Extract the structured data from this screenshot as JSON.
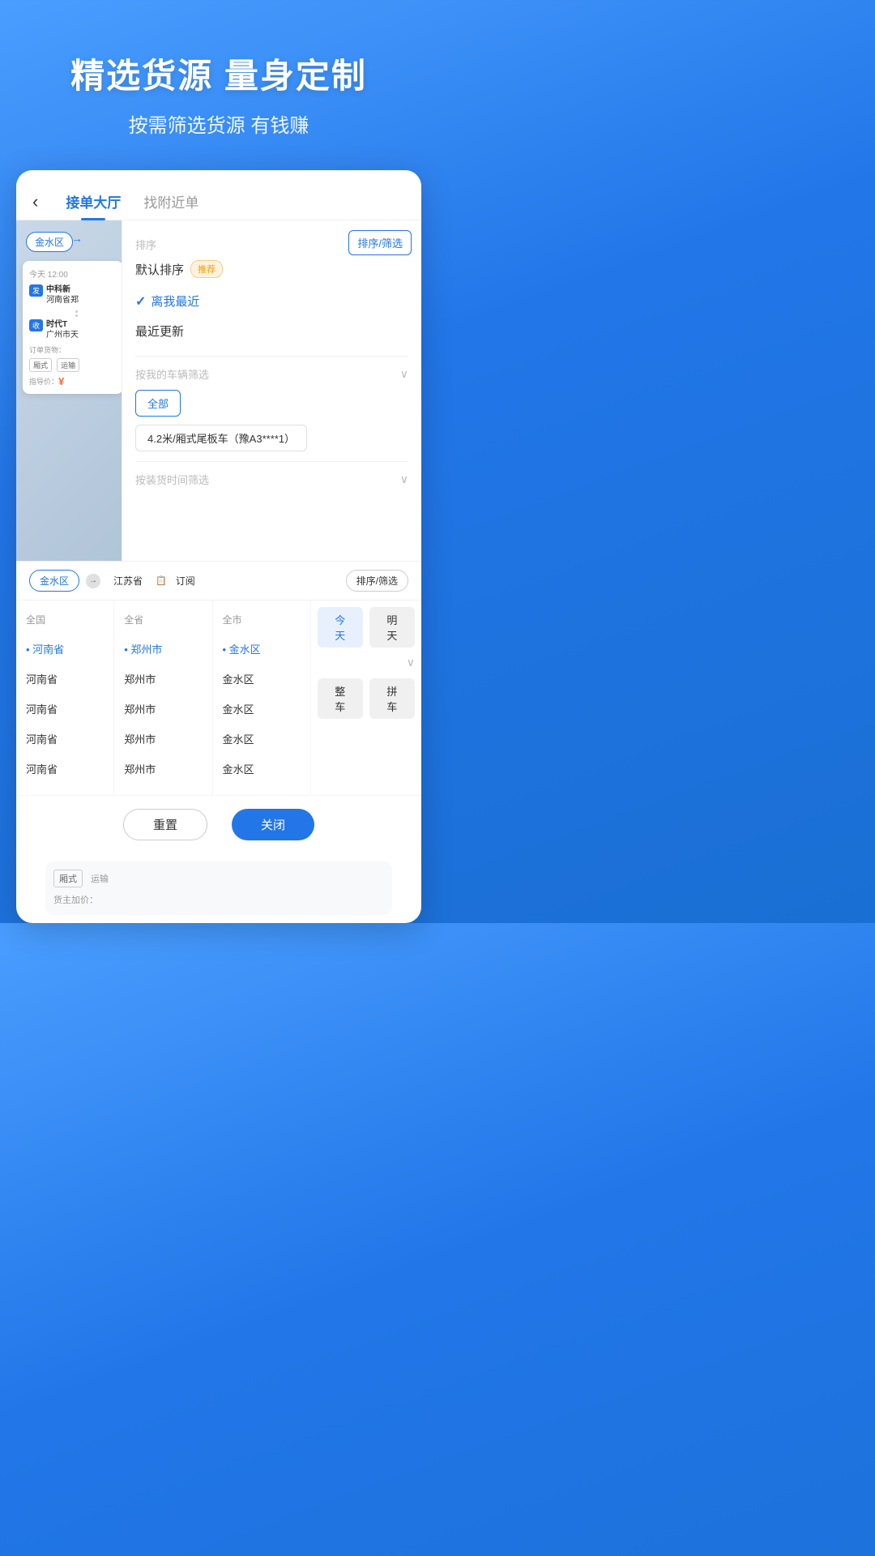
{
  "hero": {
    "title": "精选货源 量身定制",
    "subtitle": "按需筛选货源 有钱赚"
  },
  "tabs": {
    "back_label": "‹",
    "active_tab": "接单大厅",
    "inactive_tab": "找附近单"
  },
  "filter_panel": {
    "sort_filter_btn": "排序/筛选",
    "sort_label": "排序",
    "default_sort": "默认排序",
    "recommended_badge": "推荐",
    "option_nearest": "离我最近",
    "option_recent": "最近更新",
    "vehicle_filter_label": "按我的车辆筛选",
    "all_btn": "全部",
    "vehicle_option": "4.2米/厢式尾板车（豫A3****1）",
    "time_filter_label": "按装货时间筛选"
  },
  "bottom_bar": {
    "region_tag": "金水区",
    "arrow": "→",
    "province_tag": "江苏省",
    "subscribe_tag": "订阅",
    "sort_btn": "排序/筛选",
    "today_btn": "今天",
    "tomorrow_btn": "明天"
  },
  "location_picker": {
    "all_country": "全国",
    "all_province": "全省",
    "all_city": "全市",
    "col1_selected": "河南省",
    "col2_selected": "郑州市",
    "col3_selected": "金水区",
    "col1_items": [
      "河南省",
      "河南省",
      "河南省",
      "河南省"
    ],
    "col2_items": [
      "郑州市",
      "郑州市",
      "郑州市",
      "郑州市"
    ],
    "col3_items": [
      "金水区",
      "金水区",
      "金水区",
      "金水区"
    ],
    "cargo_options": {
      "whole_car": "整车",
      "carpool": "拼车"
    }
  },
  "action_buttons": {
    "reset": "重置",
    "close": "关闭"
  },
  "order_card": {
    "time": "今天 12:00",
    "from_label": "发",
    "from_name": "中科新",
    "from_addr": "河南省郑",
    "to_label": "收",
    "to_name": "时代T",
    "to_addr": "广州市天",
    "goods_label": "订单货物：",
    "goods_tag": "厢式",
    "transport_label": "运输",
    "price_label": "指导价：",
    "price_symbol": "¥"
  },
  "bottom_order": {
    "goods_tag": "厢式",
    "transport_label": "运输",
    "price_label": "货主加价："
  }
}
